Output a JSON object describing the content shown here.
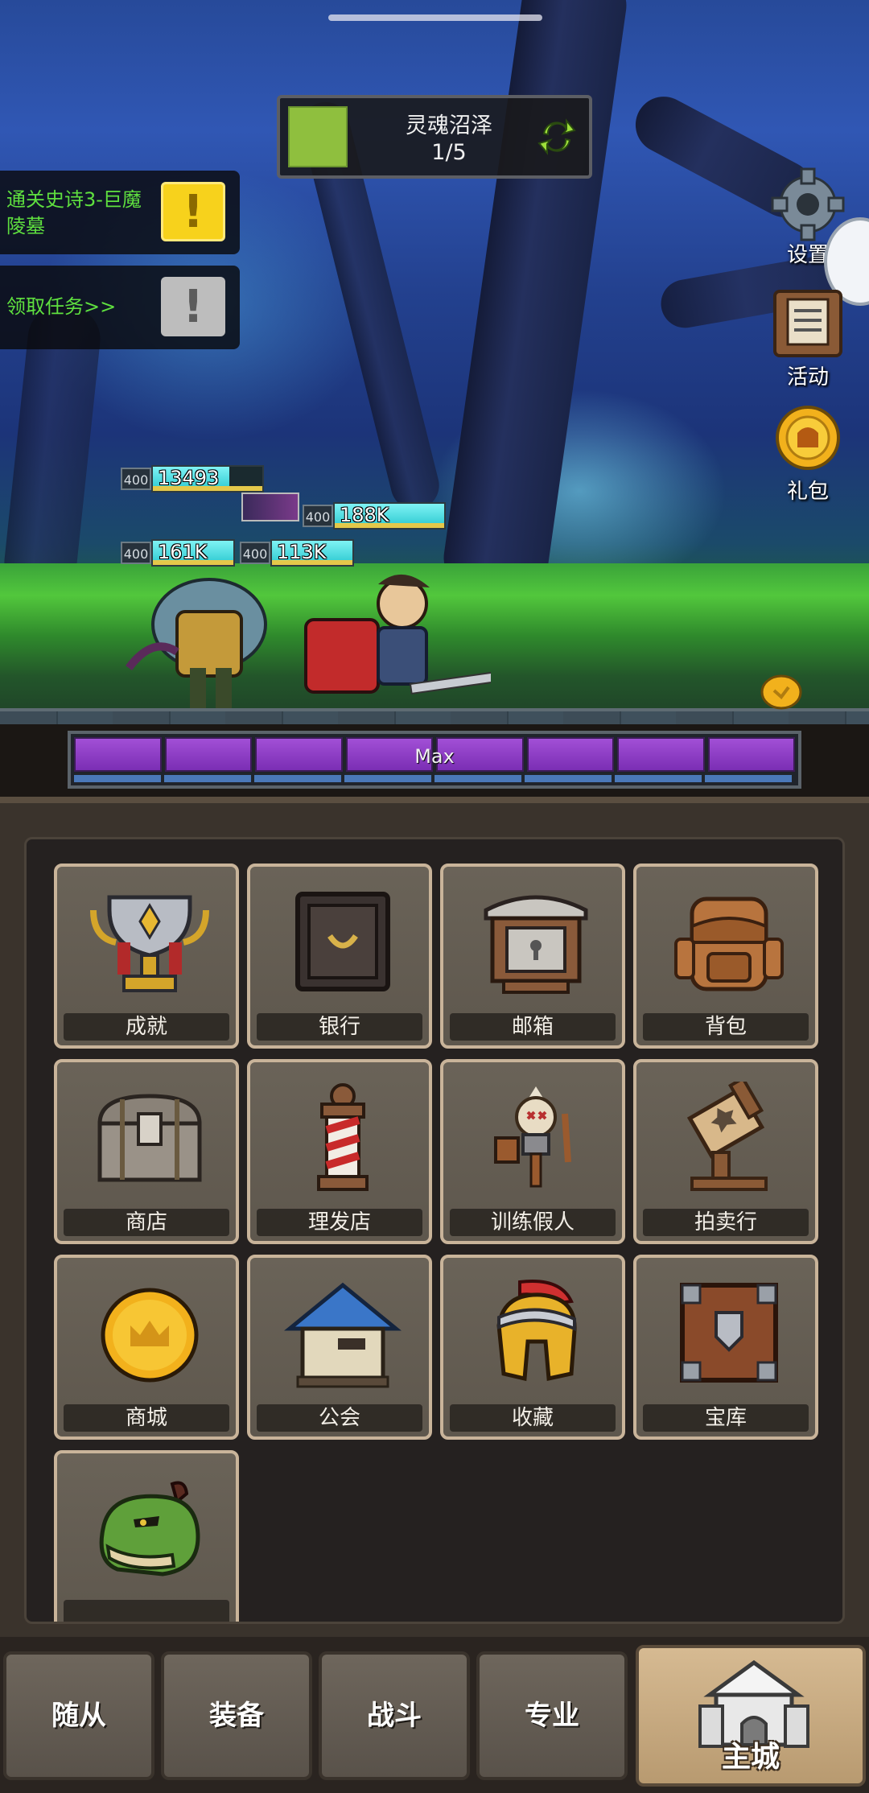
{
  "stage": {
    "name": "灵魂沼泽",
    "progress_text": "1/5",
    "progress_fraction": 0.2
  },
  "quests": [
    {
      "text": "通关史诗3-巨魔陵墓",
      "badge": "!",
      "badge_color": "#f7d21c"
    },
    {
      "text": "领取任务>>",
      "badge": "!",
      "badge_color": "#bdbdbd"
    }
  ],
  "side_buttons": {
    "settings": "设置",
    "events": "活动",
    "gift": "礼包"
  },
  "units": [
    {
      "level": "400",
      "hp": "13493"
    },
    {
      "level": "400",
      "hp": "188K"
    },
    {
      "level": "400",
      "hp": "161K"
    },
    {
      "level": "400",
      "hp": "113K"
    }
  ],
  "mana": {
    "label": "Max",
    "cells": 8
  },
  "menu": {
    "tiles": [
      {
        "label": "成就",
        "icon": "trophy-icon"
      },
      {
        "label": "银行",
        "icon": "safe-icon"
      },
      {
        "label": "邮箱",
        "icon": "mailbox-icon"
      },
      {
        "label": "背包",
        "icon": "backpack-icon"
      },
      {
        "label": "商店",
        "icon": "chest-icon"
      },
      {
        "label": "理发店",
        "icon": "barber-pole-icon"
      },
      {
        "label": "训练假人",
        "icon": "training-dummy-icon"
      },
      {
        "label": "拍卖行",
        "icon": "gavel-icon"
      },
      {
        "label": "商城",
        "icon": "gold-coin-icon"
      },
      {
        "label": "公会",
        "icon": "guild-house-icon"
      },
      {
        "label": "收藏",
        "icon": "helmet-icon"
      },
      {
        "label": "宝库",
        "icon": "vault-icon"
      },
      {
        "label": "",
        "icon": "dragon-icon"
      }
    ]
  },
  "nav": {
    "tabs": [
      "随从",
      "装备",
      "战斗",
      "专业"
    ],
    "main": "主城"
  }
}
